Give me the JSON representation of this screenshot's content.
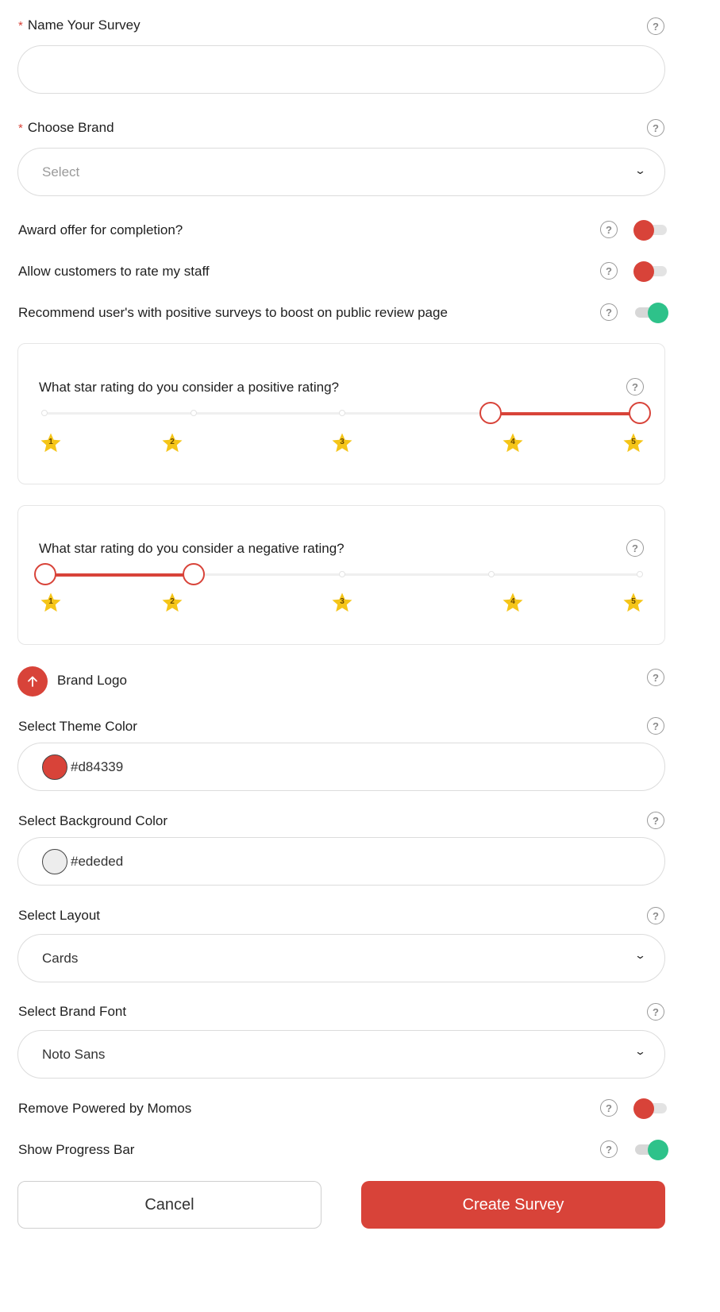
{
  "survey_name": {
    "label": "Name Your Survey",
    "required_mark": "*",
    "value": ""
  },
  "brand": {
    "label": "Choose Brand",
    "required_mark": "*",
    "placeholder": "Select"
  },
  "toggles": [
    {
      "label": "Award offer for completion?",
      "on": false
    },
    {
      "label": "Allow customers to rate my staff",
      "on": false
    },
    {
      "label": "Recommend user's with positive surveys to boost on public review page",
      "on": true
    }
  ],
  "positive_rating": {
    "question": "What star rating do you consider a positive rating?",
    "range": [
      4,
      5
    ],
    "stars": [
      "1",
      "2",
      "3",
      "4",
      "5"
    ]
  },
  "negative_rating": {
    "question": "What star rating do you consider a negative rating?",
    "range": [
      1,
      2
    ],
    "stars": [
      "1",
      "2",
      "3",
      "4",
      "5"
    ]
  },
  "brand_logo": {
    "label": "Brand Logo"
  },
  "theme_color": {
    "label": "Select Theme Color",
    "value": "#d84339"
  },
  "background_color": {
    "label": "Select Background Color",
    "value": "#ededed"
  },
  "layout": {
    "label": "Select Layout",
    "value": "Cards"
  },
  "brand_font": {
    "label": "Select Brand Font",
    "value": "Noto Sans"
  },
  "bottom_toggles": [
    {
      "label": "Remove Powered by Momos",
      "on": false
    },
    {
      "label": "Show Progress Bar",
      "on": true
    }
  ],
  "buttons": {
    "cancel": "Cancel",
    "create": "Create Survey"
  },
  "help_glyph": "?",
  "colors": {
    "accent": "#d84339",
    "toggle_on": "#2ec28a",
    "star": "#f5c518"
  }
}
